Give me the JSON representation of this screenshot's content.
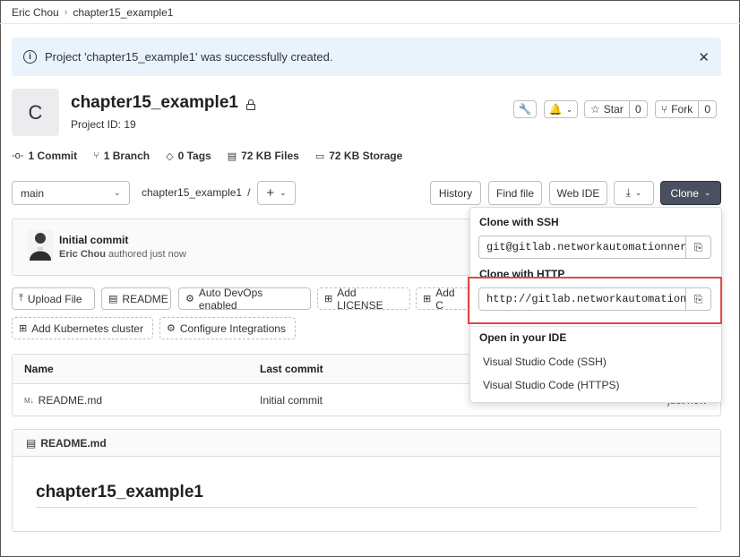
{
  "breadcrumb": {
    "user": "Eric Chou",
    "project": "chapter15_example1"
  },
  "alert": {
    "message": "Project 'chapter15_example1' was successfully created."
  },
  "project": {
    "avatar_letter": "C",
    "name": "chapter15_example1",
    "id_label": "Project ID: 19",
    "star_label": "Star",
    "star_count": "0",
    "fork_label": "Fork",
    "fork_count": "0"
  },
  "stats": {
    "commits": "1 Commit",
    "branches": "1 Branch",
    "tags": "0 Tags",
    "files": "72 KB Files",
    "storage": "72 KB Storage"
  },
  "nav": {
    "branch": "main",
    "path": "chapter15_example1",
    "path_sep": "/",
    "add": "+",
    "history": "History",
    "find_file": "Find file",
    "web_ide": "Web IDE",
    "clone": "Clone"
  },
  "commit": {
    "title": "Initial commit",
    "author": "Eric Chou",
    "meta": "authored just now"
  },
  "actions": {
    "upload": "Upload File",
    "readme": "README",
    "autodevops": "Auto DevOps enabled",
    "add_license": "Add LICENSE",
    "add_c": "Add C",
    "add_k8s": "Add Kubernetes cluster",
    "configure": "Configure Integrations"
  },
  "files": {
    "headers": {
      "name": "Name",
      "last_commit": "Last commit"
    },
    "rows": [
      {
        "name": "README.md",
        "commit": "Initial commit",
        "time": "just now"
      }
    ]
  },
  "readme": {
    "filename": "README.md",
    "heading": "chapter15_example1"
  },
  "clone_dropdown": {
    "ssh_label": "Clone with SSH",
    "ssh_url": "git@gitlab.networkautomationner",
    "http_label": "Clone with HTTP",
    "http_url": "http://gitlab.networkautomation",
    "ide_label": "Open in your IDE",
    "ide_items": [
      "Visual Studio Code (SSH)",
      "Visual Studio Code (HTTPS)"
    ]
  },
  "colors": {
    "alert_bg": "#e9f3fc",
    "clone_btn": "#4a5060",
    "highlight": "#e04a45"
  }
}
